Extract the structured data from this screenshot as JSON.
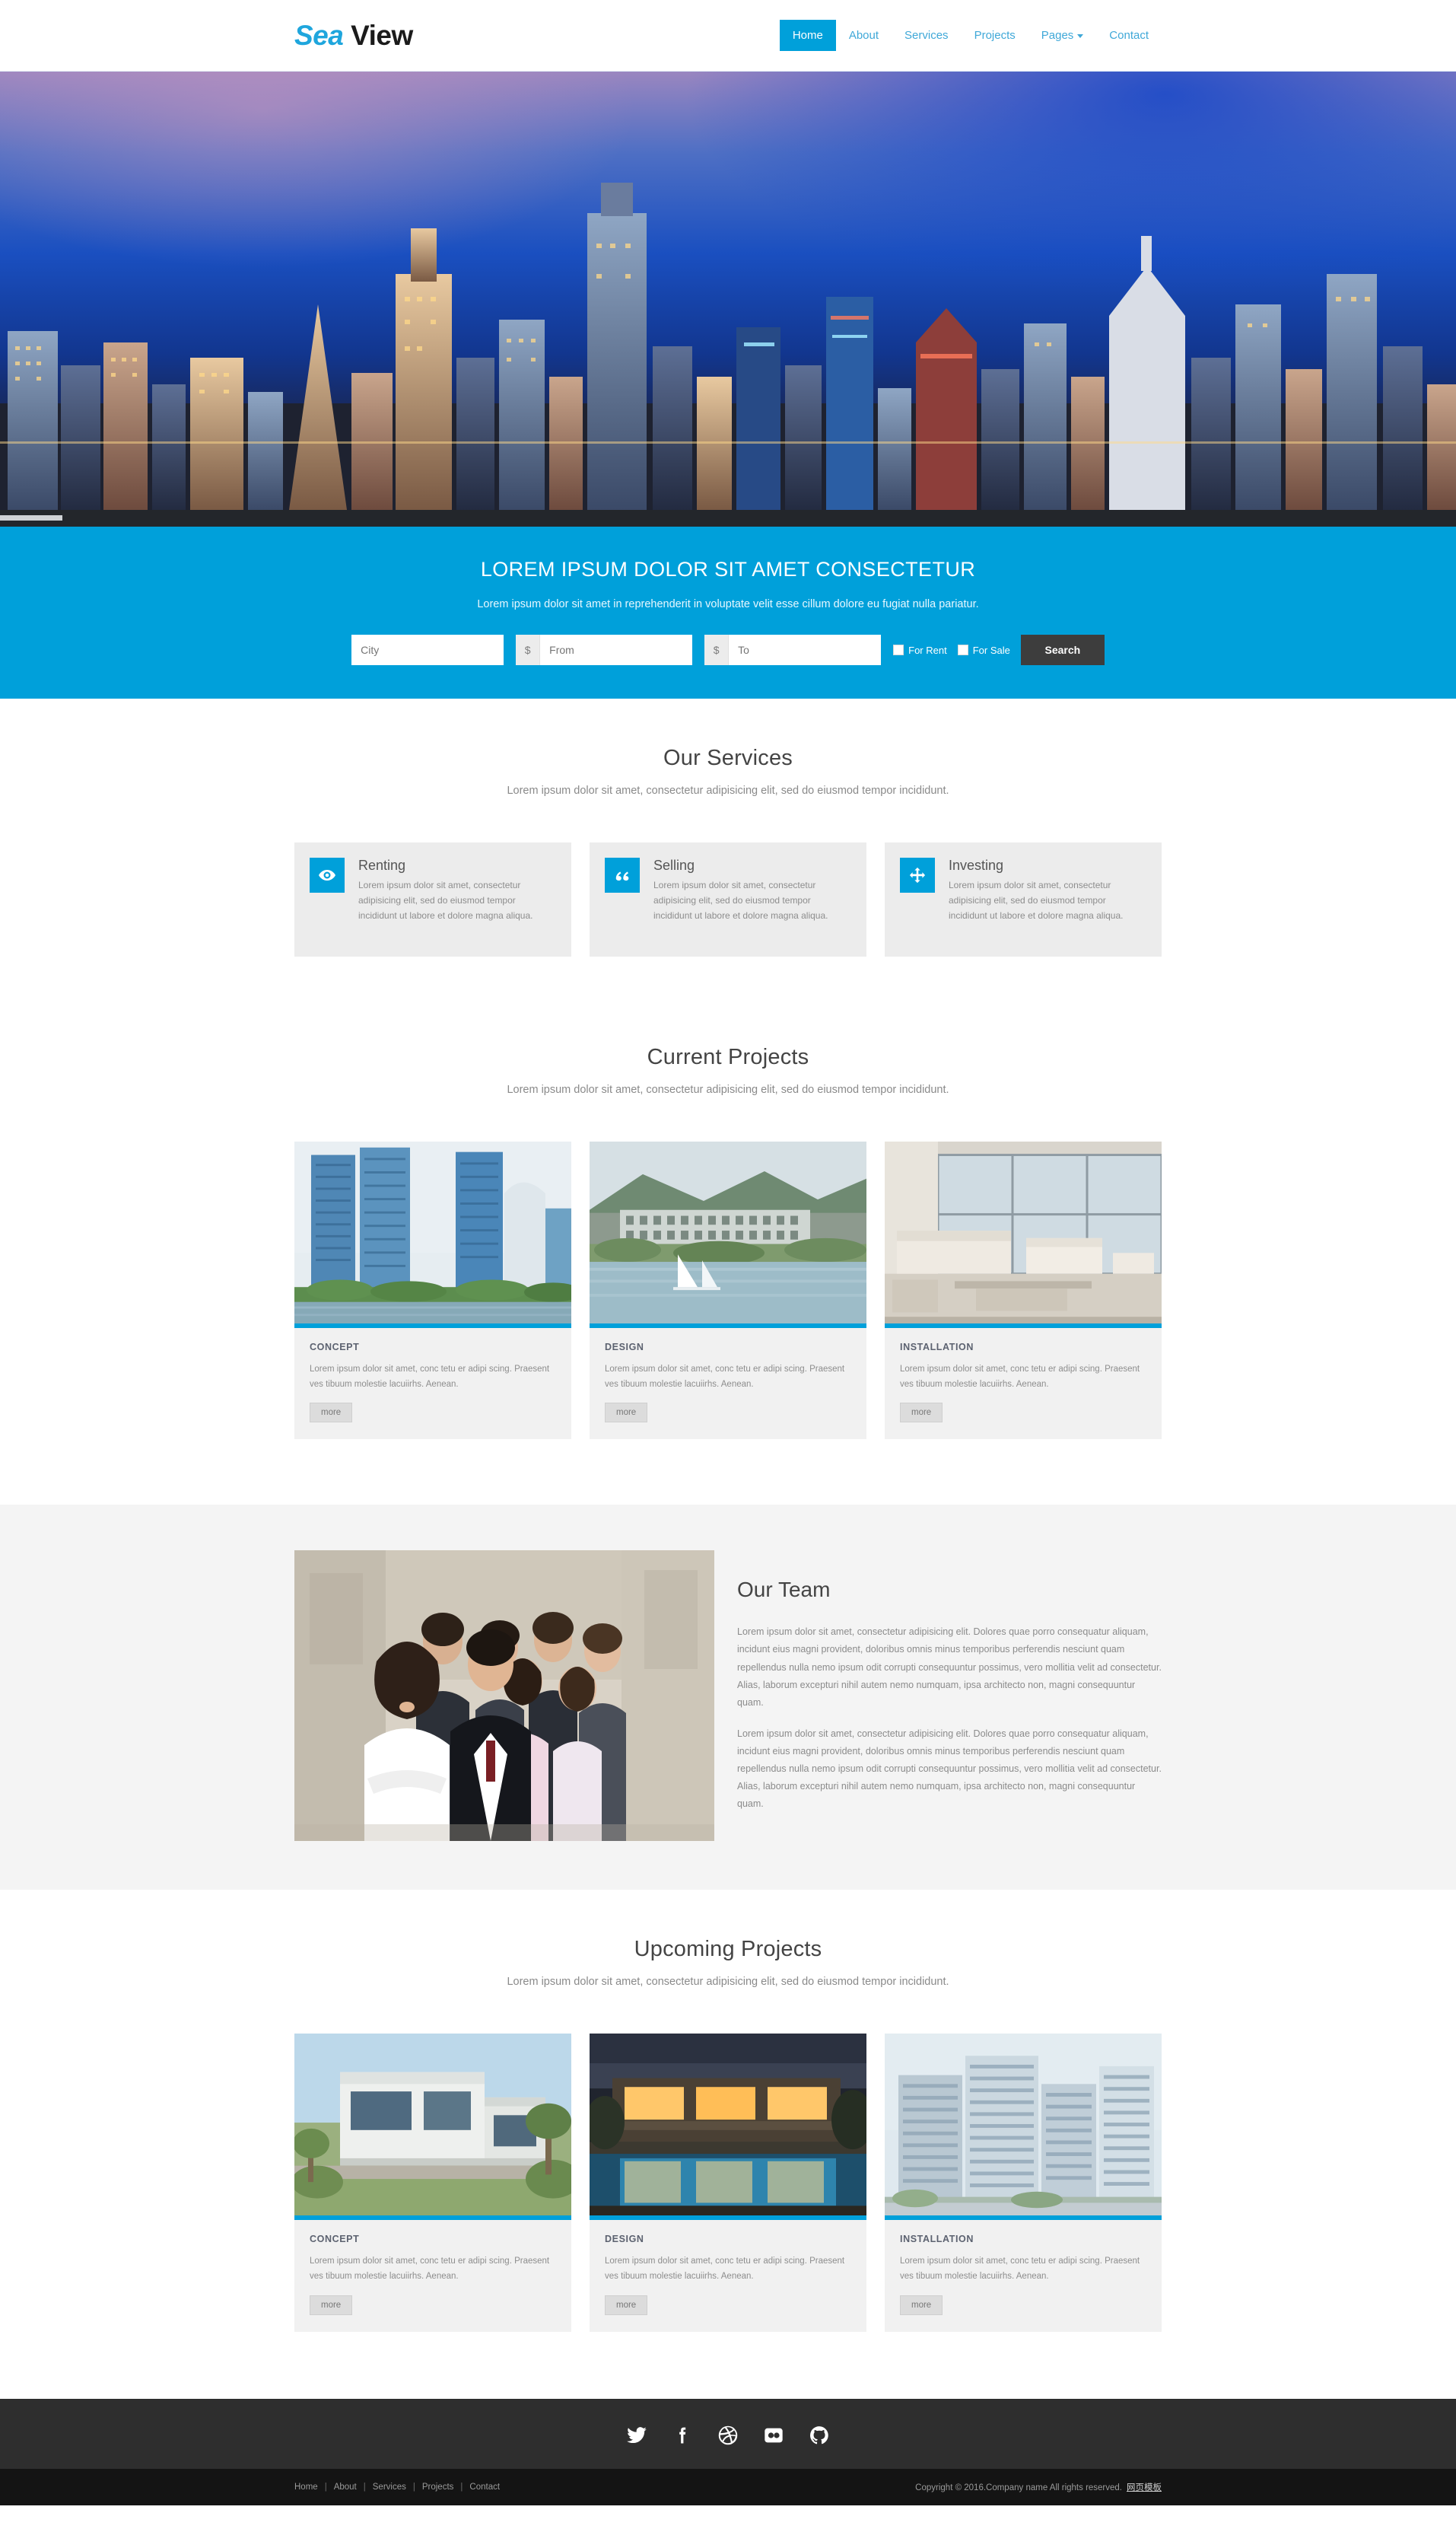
{
  "header": {
    "logo_part1": "Sea",
    "logo_part2": "View",
    "nav": [
      {
        "label": "Home",
        "active": true
      },
      {
        "label": "About",
        "active": false
      },
      {
        "label": "Services",
        "active": false
      },
      {
        "label": "Projects",
        "active": false
      },
      {
        "label": "Pages",
        "active": false,
        "dropdown": true
      },
      {
        "label": "Contact",
        "active": false
      }
    ]
  },
  "hero": {
    "title": "LOREM IPSUM DOLOR SIT AMET CONSECTETUR",
    "subtitle": "Lorem ipsum dolor sit amet in reprehenderit in voluptate velit esse cillum dolore eu fugiat nulla pariatur.",
    "search": {
      "city_placeholder": "City",
      "currency_symbol": "$",
      "from_placeholder": "From",
      "to_placeholder": "To",
      "for_rent_label": "For Rent",
      "for_sale_label": "For Sale",
      "search_button": "Search"
    }
  },
  "services": {
    "title": "Our Services",
    "subtitle": "Lorem ipsum dolor sit amet, consectetur adipisicing elit, sed do eiusmod tempor incididunt.",
    "cards": [
      {
        "icon": "eye-icon",
        "title": "Renting",
        "text": "Lorem ipsum dolor sit amet, consectetur adipisicing elit, sed do eiusmod tempor incididunt ut labore et dolore magna aliqua."
      },
      {
        "icon": "quote-icon",
        "title": "Selling",
        "text": "Lorem ipsum dolor sit amet, consectetur adipisicing elit, sed do eiusmod tempor incididunt ut labore et dolore magna aliqua."
      },
      {
        "icon": "move-arrows-icon",
        "title": "Investing",
        "text": "Lorem ipsum dolor sit amet, consectetur adipisicing elit, sed do eiusmod tempor incididunt ut labore et dolore magna aliqua."
      }
    ]
  },
  "current_projects": {
    "title": "Current Projects",
    "subtitle": "Lorem ipsum dolor sit amet, consectetur adipisicing elit, sed do eiusmod tempor incididunt.",
    "cards": [
      {
        "label": "CONCEPT",
        "text": "Lorem ipsum dolor sit amet, conc tetu er adipi scing. Praesent ves tibuum molestie lacuiirhs. Aenean.",
        "button": "more"
      },
      {
        "label": "DESIGN",
        "text": "Lorem ipsum dolor sit amet, conc tetu er adipi scing. Praesent ves tibuum molestie lacuiirhs. Aenean.",
        "button": "more"
      },
      {
        "label": "INSTALLATION",
        "text": "Lorem ipsum dolor sit amet, conc tetu er adipi scing. Praesent ves tibuum molestie lacuiirhs. Aenean.",
        "button": "more"
      }
    ]
  },
  "team": {
    "title": "Our Team",
    "paragraph1": "Lorem ipsum dolor sit amet, consectetur adipisicing elit. Dolores quae porro consequatur aliquam, incidunt eius magni provident, doloribus omnis minus temporibus perferendis nesciunt quam repellendus nulla nemo ipsum odit corrupti consequuntur possimus, vero mollitia velit ad consectetur. Alias, laborum excepturi nihil autem nemo numquam, ipsa architecto non, magni consequuntur quam.",
    "paragraph2": "Lorem ipsum dolor sit amet, consectetur adipisicing elit. Dolores quae porro consequatur aliquam, incidunt eius magni provident, doloribus omnis minus temporibus perferendis nesciunt quam repellendus nulla nemo ipsum odit corrupti consequuntur possimus, vero mollitia velit ad consectetur. Alias, laborum excepturi nihil autem nemo numquam, ipsa architecto non, magni consequuntur quam."
  },
  "upcoming_projects": {
    "title": "Upcoming Projects",
    "subtitle": "Lorem ipsum dolor sit amet, consectetur adipisicing elit, sed do eiusmod tempor incididunt.",
    "cards": [
      {
        "label": "CONCEPT",
        "text": "Lorem ipsum dolor sit amet, conc tetu er adipi scing. Praesent ves tibuum molestie lacuiirhs. Aenean.",
        "button": "more"
      },
      {
        "label": "DESIGN",
        "text": "Lorem ipsum dolor sit amet, conc tetu er adipi scing. Praesent ves tibuum molestie lacuiirhs. Aenean.",
        "button": "more"
      },
      {
        "label": "INSTALLATION",
        "text": "Lorem ipsum dolor sit amet, conc tetu er adipi scing. Praesent ves tibuum molestie lacuiirhs. Aenean.",
        "button": "more"
      }
    ]
  },
  "footer": {
    "social": [
      {
        "name": "twitter-icon"
      },
      {
        "name": "facebook-icon"
      },
      {
        "name": "dribbble-icon"
      },
      {
        "name": "flickr-icon"
      },
      {
        "name": "github-icon"
      }
    ],
    "nav": [
      "Home",
      "About",
      "Services",
      "Projects",
      "Contact"
    ],
    "copyright": "Copyright © 2016.Company name All rights reserved.",
    "copyright_cn": "网页模板"
  },
  "colors": {
    "accent": "#00a0da",
    "nav_link": "#3fa8d8",
    "dark": "#2e2e2e",
    "darker": "#141414",
    "card_grey": "#ececec",
    "section_grey": "#f4f4f4"
  }
}
